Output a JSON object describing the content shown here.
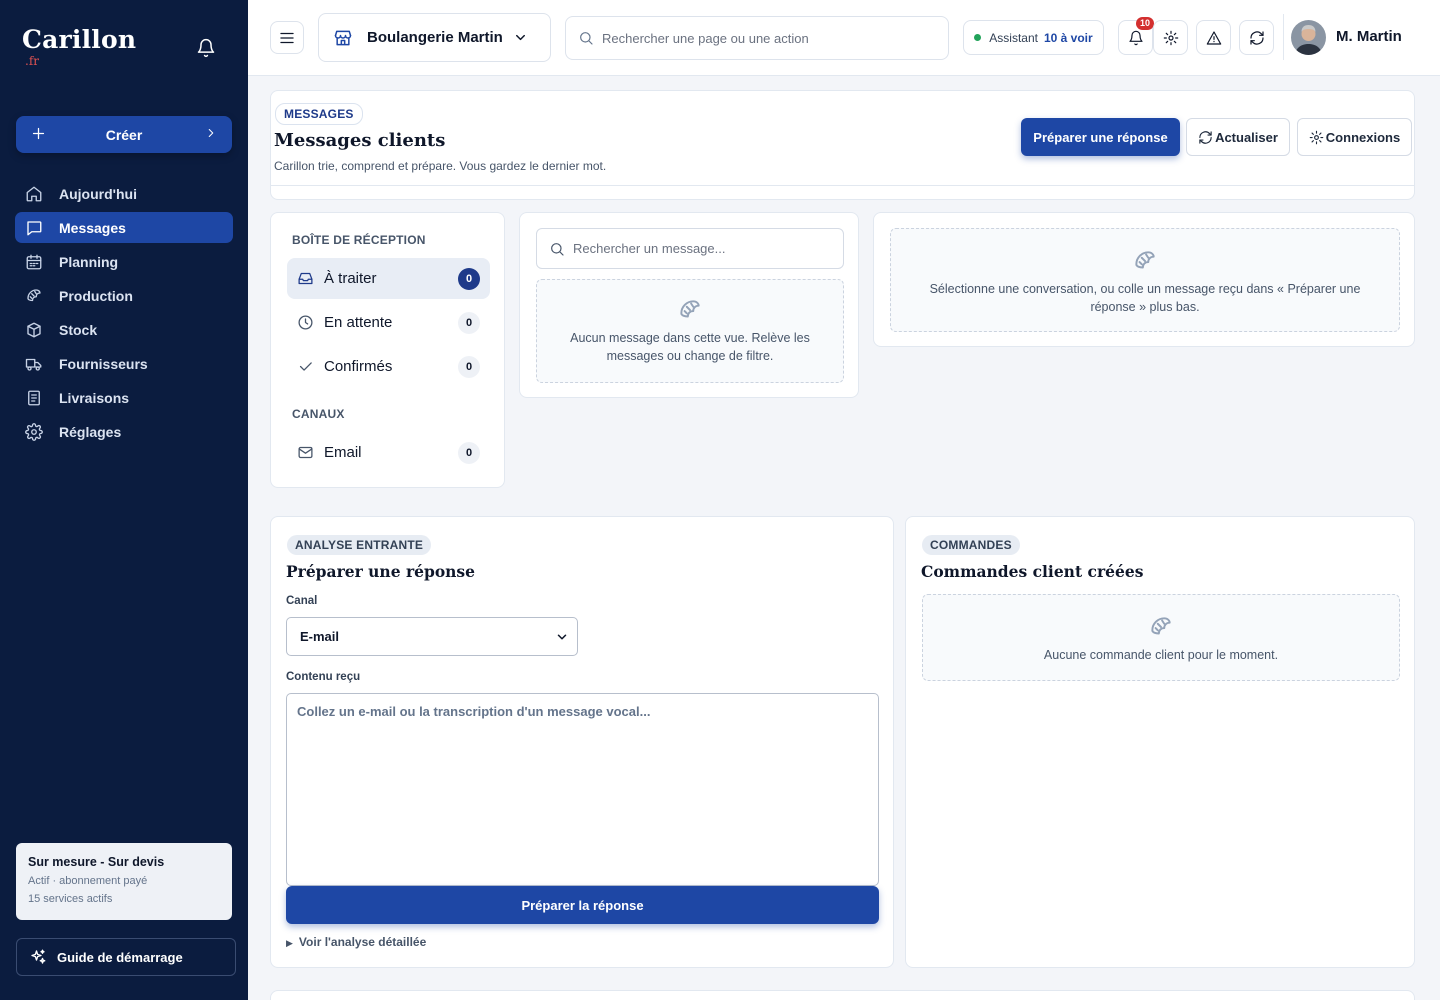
{
  "brand": {
    "name": "Carillon",
    "tld": ".fr"
  },
  "sidebar": {
    "create_label": "Créer",
    "nav": [
      {
        "label": "Aujourd'hui",
        "icon": "home-icon"
      },
      {
        "label": "Messages",
        "icon": "message-icon",
        "active": true
      },
      {
        "label": "Planning",
        "icon": "calendar-icon"
      },
      {
        "label": "Production",
        "icon": "croissant-icon"
      },
      {
        "label": "Stock",
        "icon": "box-icon"
      },
      {
        "label": "Fournisseurs",
        "icon": "truck-icon"
      },
      {
        "label": "Livraisons",
        "icon": "receipt-icon"
      },
      {
        "label": "Réglages",
        "icon": "gear-icon"
      }
    ],
    "plan": {
      "title": "Sur mesure - Sur devis",
      "status": "Actif · abonnement payé",
      "services": "15 services actifs"
    },
    "guide_label": "Guide de démarrage"
  },
  "topbar": {
    "shop_name": "Boulangerie Martin",
    "search_placeholder": "Rechercher une page ou une action",
    "assistant_label": "Assistant",
    "assistant_count": "10 à voir",
    "notif_badge": "10",
    "user_name": "M. Martin"
  },
  "header": {
    "tag": "MESSAGES",
    "title": "Messages clients",
    "subtitle": "Carillon trie, comprend et prépare. Vous gardez le dernier mot.",
    "primary_action": "Préparer une réponse",
    "refresh_action": "Actualiser",
    "connections_action": "Connexions"
  },
  "inbox": {
    "section_label": "BOÎTE DE RÉCEPTION",
    "items": [
      {
        "label": "À traiter",
        "count": "0"
      },
      {
        "label": "En attente",
        "count": "0"
      },
      {
        "label": "Confirmés",
        "count": "0"
      }
    ],
    "channels_label": "CANAUX",
    "channels": [
      {
        "label": "Email",
        "count": "0"
      }
    ]
  },
  "message_list": {
    "search_placeholder": "Rechercher un message...",
    "empty_text": "Aucun message dans cette vue. Relève les messages ou change de filtre."
  },
  "detail": {
    "empty_text": "Sélectionne une conversation, ou colle un message reçu dans « Préparer une réponse » plus bas."
  },
  "analysis": {
    "tag": "ANALYSE ENTRANTE",
    "title": "Préparer une réponse",
    "channel_label": "Canal",
    "channel_value": "E-mail",
    "content_label": "Contenu reçu",
    "content_placeholder": "Collez un e-mail ou la transcription d'un message vocal...",
    "submit_label": "Préparer la réponse",
    "details_label": "Voir l'analyse détaillée"
  },
  "orders": {
    "tag": "COMMANDES",
    "title": "Commandes client créées",
    "empty_text": "Aucune commande client pour le moment."
  },
  "colors": {
    "sidebar_bg": "#0b1c3f",
    "accent": "#1e47a5",
    "badge_red": "#d32f2f",
    "status_green": "#22a35a"
  }
}
